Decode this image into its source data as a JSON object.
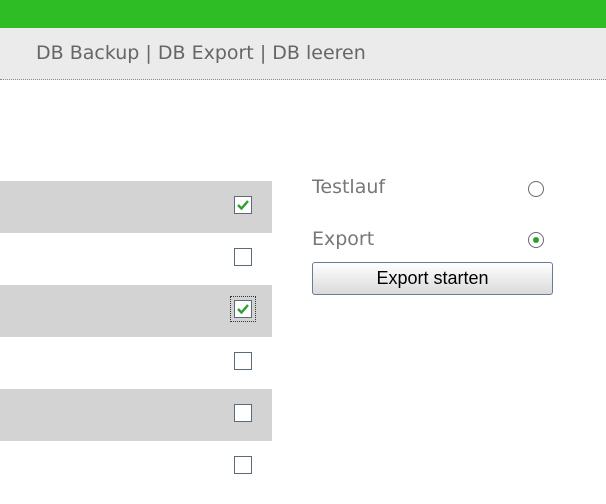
{
  "menu": {
    "links": [
      "DB Backup",
      "DB Export",
      "DB leeren"
    ],
    "separator": "|"
  },
  "rows": [
    {
      "checked": true,
      "focused": false
    },
    {
      "checked": false,
      "focused": false
    },
    {
      "checked": true,
      "focused": true
    },
    {
      "checked": false,
      "focused": false
    },
    {
      "checked": false,
      "focused": false
    },
    {
      "checked": false,
      "focused": false
    }
  ],
  "options": {
    "testlauf_label": "Testlauf",
    "testlauf_selected": false,
    "export_label": "Export",
    "export_selected": true
  },
  "export_button_label": "Export starten",
  "colors": {
    "topbar": "#2fbd25",
    "checkmark": "#2e9e2e",
    "row_shade": "#d3d3d3"
  }
}
